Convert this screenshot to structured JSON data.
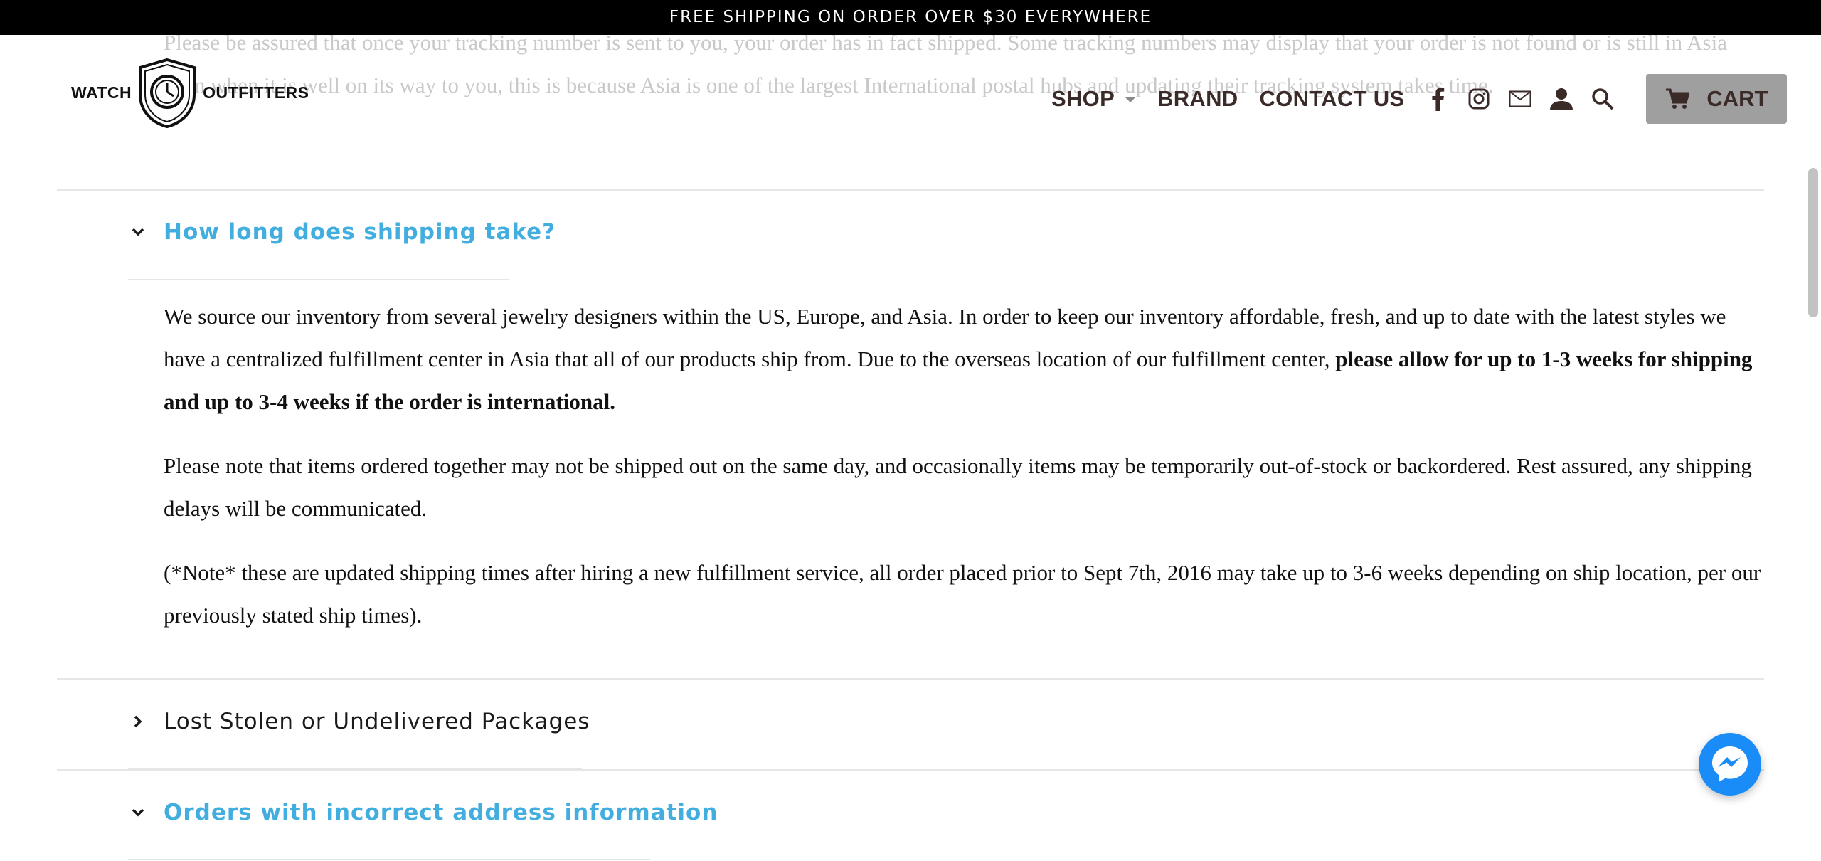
{
  "announcement": {
    "text": "FREE SHIPPING ON ORDER OVER $30 EVERYWHERE"
  },
  "faded_text": "Please be assured that once your tracking number is sent to you, your order has in fact shipped. Some tracking numbers may display that your order is not found or is still in Asia even when it is well on its way to you, this is because Asia is one of the largest International postal hubs and updating their tracking system takes time.",
  "logo": {
    "left_word": "WATCH",
    "right_word": "OUTFITTERS"
  },
  "nav": {
    "shop": "SHOP",
    "brand": "BRAND",
    "contact": "CONTACT US",
    "cart": "CART"
  },
  "icons": {
    "dropdown": "chevron-down-icon",
    "facebook": "facebook-icon",
    "instagram": "instagram-icon",
    "email": "mail-icon",
    "account": "user-icon",
    "search": "search-icon",
    "cart": "cart-icon",
    "messenger": "messenger-icon"
  },
  "faq": [
    {
      "question": "How long does shipping take?",
      "state": "open",
      "answer": {
        "p1_text": "We source our inventory from several jewelry designers within the US, Europe, and Asia. In order to keep our inventory affordable, fresh, and up to date with the latest styles we have a centralized fulfillment center in Asia that all of our products ship from. Due to the overseas location of our fulfillment center, ",
        "p1_bold": "please allow for up to 1-3 weeks for shipping and up to 3-4 weeks if the order is international.",
        "p2": "Please note that items ordered together may not be shipped out on the same day, and occasionally items may be temporarily out-of-stock or backordered. Rest assured, any shipping delays will be communicated.",
        "p3": "(*Note* these are updated shipping times after hiring a new fulfillment service, all order placed prior to Sept 7th, 2016 may take up to 3-6 weeks depending on ship location, per our previously stated ship times)."
      }
    },
    {
      "question": "Lost Stolen or Undelivered Packages",
      "state": "closed"
    },
    {
      "question": "Orders with incorrect address information",
      "state": "open"
    }
  ],
  "colors": {
    "accent": "#42aee0",
    "nav_text": "#3a2a28",
    "cart_bg": "#9f9f9f",
    "messenger": "#1a8cf7"
  }
}
